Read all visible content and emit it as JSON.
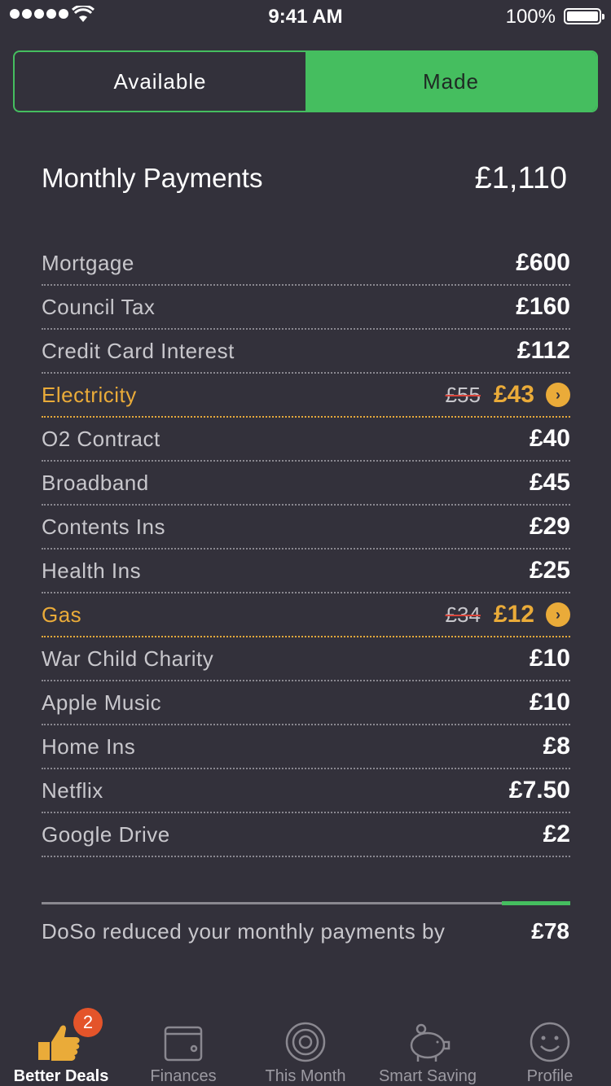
{
  "status": {
    "time": "9:41 AM",
    "battery": "100%"
  },
  "segments": {
    "available": "Available",
    "made": "Made"
  },
  "summary": {
    "title": "Monthly Payments",
    "total": "£1,110"
  },
  "payments": [
    {
      "label": "Mortgage",
      "amount": "£600"
    },
    {
      "label": "Council Tax",
      "amount": "£160"
    },
    {
      "label": "Credit Card Interest",
      "amount": "£112"
    },
    {
      "label": "Electricity",
      "old_amount": "£55",
      "amount": "£43",
      "highlight": true
    },
    {
      "label": "O2 Contract",
      "amount": "£40"
    },
    {
      "label": "Broadband",
      "amount": "£45"
    },
    {
      "label": "Contents Ins",
      "amount": "£29"
    },
    {
      "label": "Health Ins",
      "amount": "£25"
    },
    {
      "label": "Gas",
      "old_amount": "£34",
      "amount": "£12",
      "highlight": true
    },
    {
      "label": "War Child Charity",
      "amount": "£10"
    },
    {
      "label": "Apple Music",
      "amount": "£10"
    },
    {
      "label": "Home Ins",
      "amount": "£8"
    },
    {
      "label": "Netflix",
      "amount": "£7.50"
    },
    {
      "label": "Google Drive",
      "amount": "£2"
    }
  ],
  "saving": {
    "label": "DoSo reduced your monthly payments by",
    "amount": "£78",
    "progress_fraction": 0.13
  },
  "tabs": [
    {
      "label": "Better Deals",
      "icon": "thumbs-up-icon",
      "badge": "2",
      "active": true
    },
    {
      "label": "Finances",
      "icon": "wallet-icon"
    },
    {
      "label": "This Month",
      "icon": "target-icon"
    },
    {
      "label": "Smart Saving",
      "icon": "piggy-bank-icon"
    },
    {
      "label": "Profile",
      "icon": "smiley-icon"
    }
  ],
  "colors": {
    "accent": "#45be5f",
    "highlight": "#eaab39",
    "background": "#33313b",
    "badge": "#e4542a"
  }
}
